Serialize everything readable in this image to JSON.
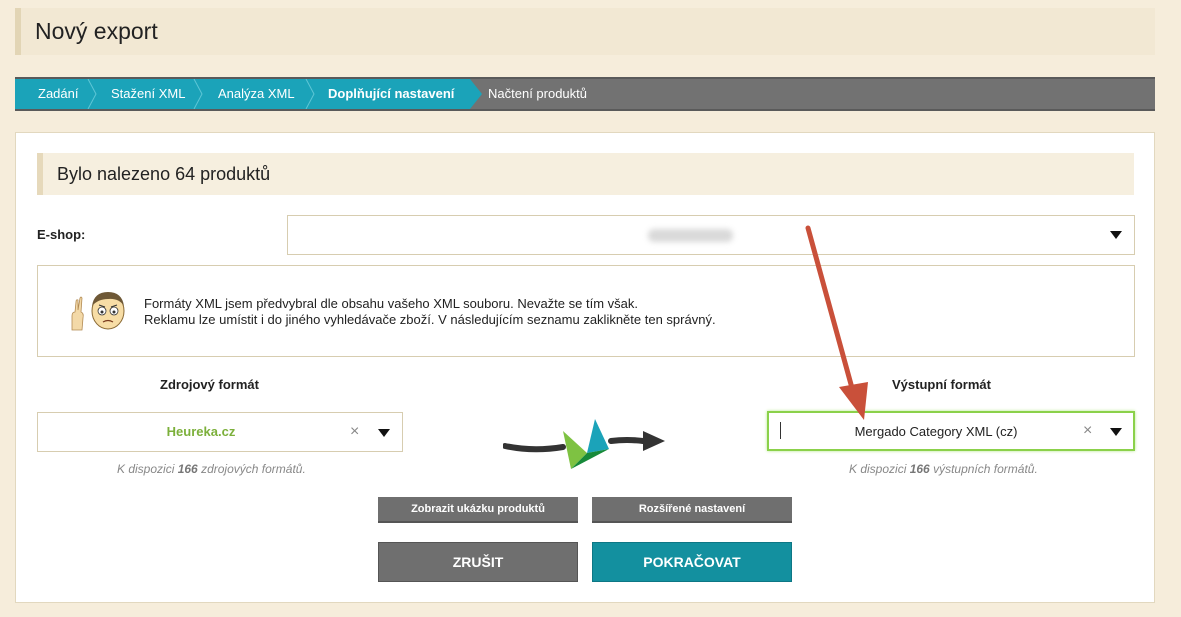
{
  "page": {
    "title": "Nový export"
  },
  "steps": [
    {
      "label": "Zadání"
    },
    {
      "label": "Stažení XML"
    },
    {
      "label": "Analýza XML"
    },
    {
      "label": "Doplňující nastavení"
    },
    {
      "label": "Načtení produktů"
    }
  ],
  "panel": {
    "title": "Bylo nalezeno 64 produktů",
    "eshop": {
      "label": "E-shop:"
    },
    "info": {
      "line1": "Formáty XML jsem předvybral dle obsahu vašeho XML souboru. Nevažte se tím však.",
      "line2": "Reklamu lze umístit i do jiného vyhledávače zboží. V následujícím seznamu zaklikněte ten správný."
    },
    "source": {
      "label": "Zdrojový formát",
      "value": "Heureka.cz",
      "avail_prefix": "K dispozici",
      "count": "166",
      "avail_suffix": "zdrojových formátů."
    },
    "output": {
      "label": "Výstupní formát",
      "value": "Mergado Category XML (cz)",
      "avail_prefix": "K dispozici",
      "count": "166",
      "avail_suffix": "výstupních formátů."
    },
    "buttons": {
      "preview": "Zobrazit ukázku produktů",
      "advanced": "Rozšířené nastavení",
      "cancel": "ZRUŠIT",
      "continue": "POKRAČOVAT"
    }
  },
  "colors": {
    "step_active": "#1ba3b9",
    "source_value": "#7cb03b",
    "output_focus": "#8bd14a",
    "continue": "#13909f",
    "annotation_arrow": "#c9503a"
  }
}
